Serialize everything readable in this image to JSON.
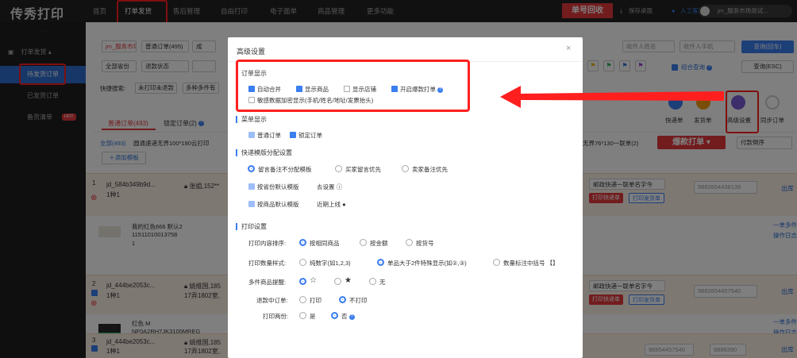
{
  "topnav": {
    "logo": "传秀打印",
    "items": [
      "首页",
      "打单发货",
      "售后管理",
      "自由打印",
      "电子面单",
      "商品管理",
      "更多功能"
    ],
    "recycle": "单号回收",
    "save_desktop": "保存桌面",
    "service": "人工客服",
    "user": "jm_服务市场测试..."
  },
  "sidebar": {
    "dots": "···",
    "group": "打单发货",
    "items": [
      "待发货订单",
      "已发货订单",
      "备货清单"
    ],
    "hot": "HOT"
  },
  "filters": {
    "shop": "jm_服务市场",
    "order_type": "普通订单(495)",
    "more": "成",
    "province": "全部省份",
    "refund": "退款状态",
    "quick_label": "快捷搜索:",
    "quick_unprinted": "未打印未退款",
    "quick_multi": "多种多件有",
    "receiver_name": "收件人姓名",
    "receiver_phone": "收件人手机",
    "query_btn": "查询(回车)",
    "combo_query": "组合查询",
    "query_esc": "查询(ESC)"
  },
  "tabs": {
    "normal": "普通订单(493)",
    "locked": "锁定订单(2)"
  },
  "order_bar": {
    "all": "全部(493)",
    "template": "圆通速递无界100*180云打印",
    "add_template": "添加模板",
    "right_template": "无界76*130一联单(2)",
    "explode": "爆款打单",
    "pay_sort": "付款倒序"
  },
  "toolbar": {
    "express": "快递单",
    "ship": "发货单",
    "advanced": "高级设置",
    "sync": "同步订单"
  },
  "orders": [
    {
      "index": "1",
      "id": "jd_584b349b9d...",
      "qty": "1种1",
      "buyer": "张姐,152**",
      "express": "邮政快递一联单名字今",
      "print_express": "打印快递单",
      "print_ship": "打印发货单",
      "tracking": "9883954438139",
      "ship_out": "出库",
      "product": "我的红色666 默认2",
      "sku": "11511010013758",
      "count": "1",
      "side1": "一单多件",
      "side2": "操作日志"
    },
    {
      "index": "2",
      "id": "jd_444be2053c...",
      "qty": "1种1",
      "buyer": "姚维国,185",
      "addr": "17弄1802室,",
      "express": "邮政快递一联单名字今",
      "print_express": "打印快递单",
      "print_ship": "打印发货单",
      "tracking": "9883954457540",
      "ship_out": "出库",
      "product": "红色 M",
      "sku": "NF0A2RH7JK3100MREG",
      "count": "1",
      "side1": "一单多件",
      "side2": "操作日志"
    },
    {
      "index": "3",
      "id": "jd_444be2053c...",
      "qty": "1种1",
      "buyer": "姚维国,185",
      "addr": "17弄1802室,",
      "tracking": "98854457540",
      "tracking2": "9888390",
      "ship_out": "出库"
    }
  ],
  "modal": {
    "title": "高级设置",
    "close": "×",
    "sections": {
      "order_display": "订单显示",
      "menu_display": "菜单显示",
      "template_assign": "快递模版分配设置",
      "print_settings": "打印设置"
    },
    "order_display": {
      "auto_merge": "自动合并",
      "show_product": "显示商品",
      "show_shop": "显示店铺",
      "explode_print": "开启爆款打单",
      "encrypt": "敏感数据加密显示(手机/姓名/地址/发票抬头)"
    },
    "menu_display": {
      "normal": "普通订单",
      "locked": "锁定订单"
    },
    "template_assign": {
      "opt1": "留言备注不分配模板",
      "opt2": "买家留言优先",
      "opt3": "卖家备注优先",
      "by_province": "按省份默认模版",
      "go_setting": "去设置",
      "by_product": "按商品默认模版",
      "coming": "近期上线"
    },
    "print": {
      "sort_label": "打印内容排序:",
      "sort_opts": [
        "按相同商品",
        "按金额",
        "按货号"
      ],
      "qty_label": "打印数量样式:",
      "qty_opts": [
        "纯数字(如1,2,3)",
        "单品大于2件特殊显示(如②,③)",
        "数量标注中括号 【】"
      ],
      "multi_label": "多件商品提醒:",
      "multi_opts": [
        "☆",
        "★",
        "无"
      ],
      "refund_label": "退款中订单:",
      "refund_opts": [
        "打印",
        "不打印"
      ],
      "twice_label": "打印两份:",
      "twice_opts": [
        "是",
        "否"
      ]
    }
  },
  "colors": {
    "accent": "#3b7ef0",
    "highlight": "#ff1f1f",
    "brand_red": "#e4393c"
  }
}
